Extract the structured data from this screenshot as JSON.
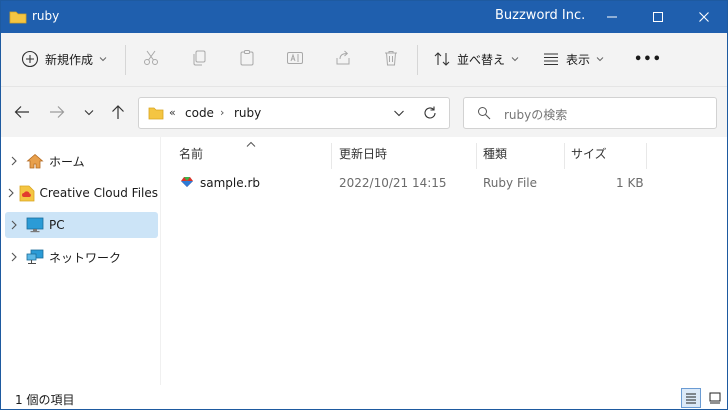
{
  "titlebar": {
    "folder_title": "ruby",
    "app_title": "Buzzword Inc.",
    "minimize_glyph": "—",
    "maximize_glyph": "□",
    "close_glyph": "✕"
  },
  "commandbar": {
    "new_label": "新規作成",
    "sort_label": "並べ替え",
    "view_label": "表示",
    "more_label": "•••",
    "icons": [
      "plus-icon",
      "cut-icon",
      "copy-icon",
      "paste-icon",
      "rename-icon",
      "share-icon",
      "delete-icon",
      "sort-icon",
      "view-icon",
      "more-icon"
    ]
  },
  "address": {
    "overflow": "«",
    "crumbs": [
      "code",
      "ruby"
    ],
    "separator": "›",
    "search_placeholder": "rubyの検索"
  },
  "navpane": {
    "items": [
      {
        "label": "ホーム",
        "icon": "home-icon",
        "selected": false
      },
      {
        "label": "Creative Cloud Files",
        "icon": "creative-cloud-folder-icon",
        "selected": false
      },
      {
        "label": "PC",
        "icon": "monitor-icon",
        "selected": true
      },
      {
        "label": "ネットワーク",
        "icon": "network-icon",
        "selected": false
      }
    ]
  },
  "columns": [
    "名前",
    "更新日時",
    "種類",
    "サイズ"
  ],
  "files": [
    {
      "name": "sample.rb",
      "modified": "2022/10/21 14:15",
      "type": "Ruby File",
      "size": "1 KB",
      "icon": "ruby-file-icon"
    }
  ],
  "status": {
    "item_count": "1 個の項目"
  },
  "colors": {
    "titlebar": "#1f5fae",
    "selection": "#cce4f7",
    "folder": "#f4c542"
  }
}
